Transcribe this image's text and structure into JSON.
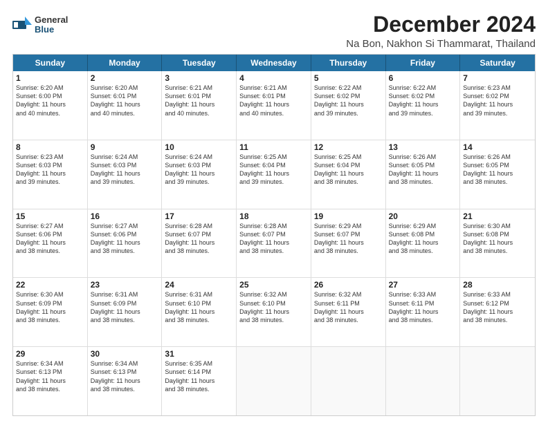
{
  "logo": {
    "general": "General",
    "blue": "Blue"
  },
  "title": "December 2024",
  "subtitle": "Na Bon, Nakhon Si Thammarat, Thailand",
  "calendar": {
    "days": [
      "Sunday",
      "Monday",
      "Tuesday",
      "Wednesday",
      "Thursday",
      "Friday",
      "Saturday"
    ],
    "weeks": [
      [
        {
          "day": "",
          "info": ""
        },
        {
          "day": "2",
          "info": "Sunrise: 6:20 AM\nSunset: 6:01 PM\nDaylight: 11 hours\nand 40 minutes."
        },
        {
          "day": "3",
          "info": "Sunrise: 6:21 AM\nSunset: 6:01 PM\nDaylight: 11 hours\nand 40 minutes."
        },
        {
          "day": "4",
          "info": "Sunrise: 6:21 AM\nSunset: 6:01 PM\nDaylight: 11 hours\nand 40 minutes."
        },
        {
          "day": "5",
          "info": "Sunrise: 6:22 AM\nSunset: 6:02 PM\nDaylight: 11 hours\nand 39 minutes."
        },
        {
          "day": "6",
          "info": "Sunrise: 6:22 AM\nSunset: 6:02 PM\nDaylight: 11 hours\nand 39 minutes."
        },
        {
          "day": "7",
          "info": "Sunrise: 6:23 AM\nSunset: 6:02 PM\nDaylight: 11 hours\nand 39 minutes."
        }
      ],
      [
        {
          "day": "1",
          "info": "Sunrise: 6:20 AM\nSunset: 6:00 PM\nDaylight: 11 hours\nand 40 minutes."
        },
        {
          "day": "",
          "info": ""
        },
        {
          "day": "",
          "info": ""
        },
        {
          "day": "",
          "info": ""
        },
        {
          "day": "",
          "info": ""
        },
        {
          "day": "",
          "info": ""
        },
        {
          "day": "",
          "info": ""
        }
      ],
      [
        {
          "day": "8",
          "info": "Sunrise: 6:23 AM\nSunset: 6:03 PM\nDaylight: 11 hours\nand 39 minutes."
        },
        {
          "day": "9",
          "info": "Sunrise: 6:24 AM\nSunset: 6:03 PM\nDaylight: 11 hours\nand 39 minutes."
        },
        {
          "day": "10",
          "info": "Sunrise: 6:24 AM\nSunset: 6:03 PM\nDaylight: 11 hours\nand 39 minutes."
        },
        {
          "day": "11",
          "info": "Sunrise: 6:25 AM\nSunset: 6:04 PM\nDaylight: 11 hours\nand 39 minutes."
        },
        {
          "day": "12",
          "info": "Sunrise: 6:25 AM\nSunset: 6:04 PM\nDaylight: 11 hours\nand 38 minutes."
        },
        {
          "day": "13",
          "info": "Sunrise: 6:26 AM\nSunset: 6:05 PM\nDaylight: 11 hours\nand 38 minutes."
        },
        {
          "day": "14",
          "info": "Sunrise: 6:26 AM\nSunset: 6:05 PM\nDaylight: 11 hours\nand 38 minutes."
        }
      ],
      [
        {
          "day": "15",
          "info": "Sunrise: 6:27 AM\nSunset: 6:06 PM\nDaylight: 11 hours\nand 38 minutes."
        },
        {
          "day": "16",
          "info": "Sunrise: 6:27 AM\nSunset: 6:06 PM\nDaylight: 11 hours\nand 38 minutes."
        },
        {
          "day": "17",
          "info": "Sunrise: 6:28 AM\nSunset: 6:07 PM\nDaylight: 11 hours\nand 38 minutes."
        },
        {
          "day": "18",
          "info": "Sunrise: 6:28 AM\nSunset: 6:07 PM\nDaylight: 11 hours\nand 38 minutes."
        },
        {
          "day": "19",
          "info": "Sunrise: 6:29 AM\nSunset: 6:07 PM\nDaylight: 11 hours\nand 38 minutes."
        },
        {
          "day": "20",
          "info": "Sunrise: 6:29 AM\nSunset: 6:08 PM\nDaylight: 11 hours\nand 38 minutes."
        },
        {
          "day": "21",
          "info": "Sunrise: 6:30 AM\nSunset: 6:08 PM\nDaylight: 11 hours\nand 38 minutes."
        }
      ],
      [
        {
          "day": "22",
          "info": "Sunrise: 6:30 AM\nSunset: 6:09 PM\nDaylight: 11 hours\nand 38 minutes."
        },
        {
          "day": "23",
          "info": "Sunrise: 6:31 AM\nSunset: 6:09 PM\nDaylight: 11 hours\nand 38 minutes."
        },
        {
          "day": "24",
          "info": "Sunrise: 6:31 AM\nSunset: 6:10 PM\nDaylight: 11 hours\nand 38 minutes."
        },
        {
          "day": "25",
          "info": "Sunrise: 6:32 AM\nSunset: 6:10 PM\nDaylight: 11 hours\nand 38 minutes."
        },
        {
          "day": "26",
          "info": "Sunrise: 6:32 AM\nSunset: 6:11 PM\nDaylight: 11 hours\nand 38 minutes."
        },
        {
          "day": "27",
          "info": "Sunrise: 6:33 AM\nSunset: 6:11 PM\nDaylight: 11 hours\nand 38 minutes."
        },
        {
          "day": "28",
          "info": "Sunrise: 6:33 AM\nSunset: 6:12 PM\nDaylight: 11 hours\nand 38 minutes."
        }
      ],
      [
        {
          "day": "29",
          "info": "Sunrise: 6:34 AM\nSunset: 6:13 PM\nDaylight: 11 hours\nand 38 minutes."
        },
        {
          "day": "30",
          "info": "Sunrise: 6:34 AM\nSunset: 6:13 PM\nDaylight: 11 hours\nand 38 minutes."
        },
        {
          "day": "31",
          "info": "Sunrise: 6:35 AM\nSunset: 6:14 PM\nDaylight: 11 hours\nand 38 minutes."
        },
        {
          "day": "",
          "info": ""
        },
        {
          "day": "",
          "info": ""
        },
        {
          "day": "",
          "info": ""
        },
        {
          "day": "",
          "info": ""
        }
      ]
    ]
  }
}
